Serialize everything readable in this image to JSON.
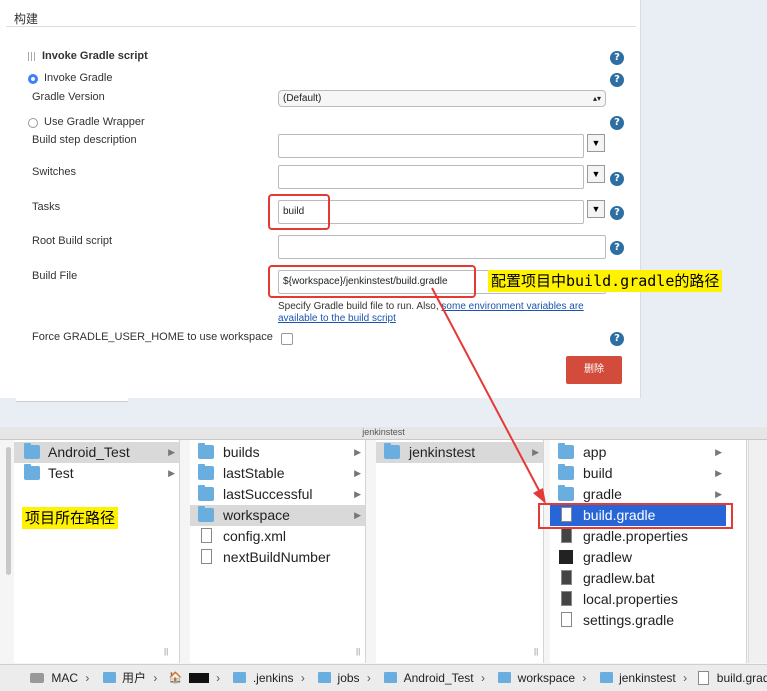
{
  "jenkins": {
    "section_title": "构建",
    "step_title": "Invoke Gradle script",
    "invoke_gradle": "Invoke Gradle",
    "gradle_version_label": "Gradle Version",
    "gradle_version_value": "(Default)",
    "use_wrapper": "Use Gradle Wrapper",
    "build_step_desc_label": "Build step description",
    "switches_label": "Switches",
    "tasks_label": "Tasks",
    "tasks_value": "build",
    "root_build_script_label": "Root Build script",
    "build_file_label": "Build File",
    "build_file_value": "${workspace}/jenkinstest/build.gradle",
    "build_file_help_prefix": "Specify Gradle build file to run. Also,",
    "build_file_help_link1": "some environment variables are",
    "build_file_help_link2": "available to the build script",
    "force_home_label": "Force GRADLE_USER_HOME to use workspace",
    "delete_button": "删除",
    "help_glyph": "?"
  },
  "annotations": {
    "build_gradle_note": "配置项目中build.gradle的路径",
    "project_path_note": "项目所在路径"
  },
  "finder": {
    "window_title": "jenkinstest",
    "col1": [
      "Android_Test",
      "Test"
    ],
    "col2": [
      "builds",
      "lastStable",
      "lastSuccessful",
      "workspace",
      "config.xml",
      "nextBuildNumber"
    ],
    "col3": [
      "jenkinstest"
    ],
    "col4": [
      "app",
      "build",
      "gradle",
      "build.gradle",
      "gradle.properties",
      "gradlew",
      "gradlew.bat",
      "local.properties",
      "settings.gradle"
    ],
    "breadcrumb": [
      "MAC",
      "用户",
      "",
      ".jenkins",
      "jobs",
      "Android_Test",
      "workspace",
      "jenkinstest",
      "build.gradle"
    ],
    "scroll_glyph": "||"
  },
  "colors": {
    "accent_red": "#e53935",
    "help_blue": "#2d6ea3",
    "selection_blue": "#2866d8",
    "highlight_yellow": "#fff200",
    "delete_red": "#d24b3b"
  }
}
